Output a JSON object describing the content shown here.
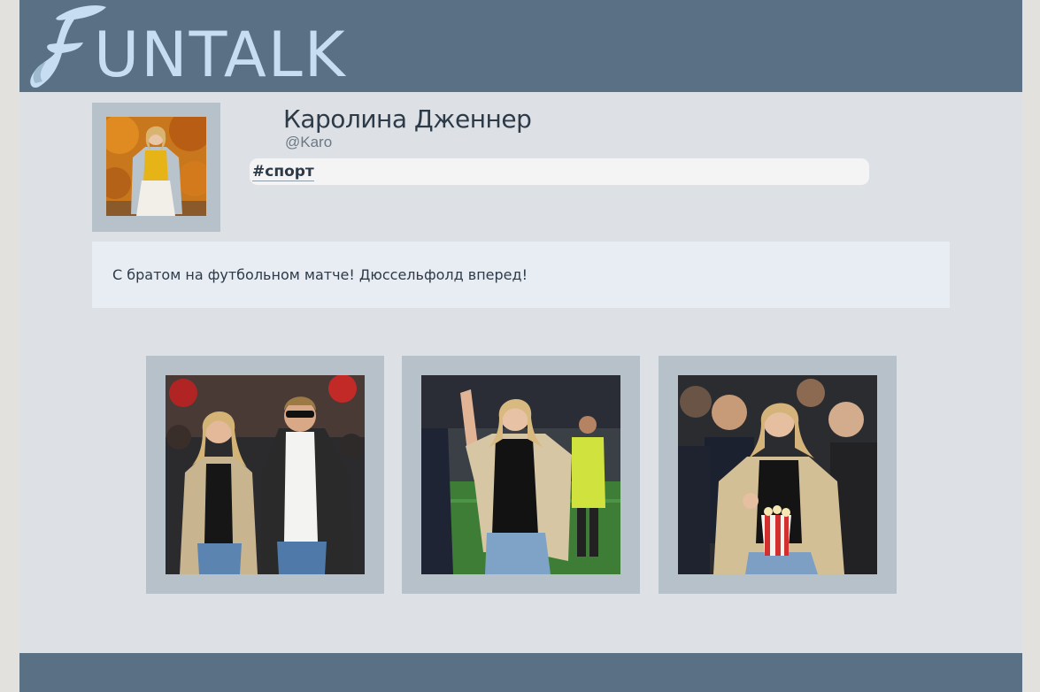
{
  "app": {
    "logo_initial": "F",
    "logo_rest": "UNTALK"
  },
  "profile": {
    "name": "Каролина Дженнер",
    "handle": "@Karo",
    "tag": "#спорт"
  },
  "post": {
    "text": "С братом на футбольном матче! Дюссельфолд вперед!"
  },
  "photos": [
    {
      "name": "photo-stadium-couple"
    },
    {
      "name": "photo-waving-on-pitch"
    },
    {
      "name": "photo-eating-popcorn"
    }
  ],
  "colors": {
    "header": "#5a7085",
    "page": "#dde1e5",
    "frame": "#b7c1ca",
    "logo": "#c7def2",
    "post_box": "#e8ecf3"
  }
}
